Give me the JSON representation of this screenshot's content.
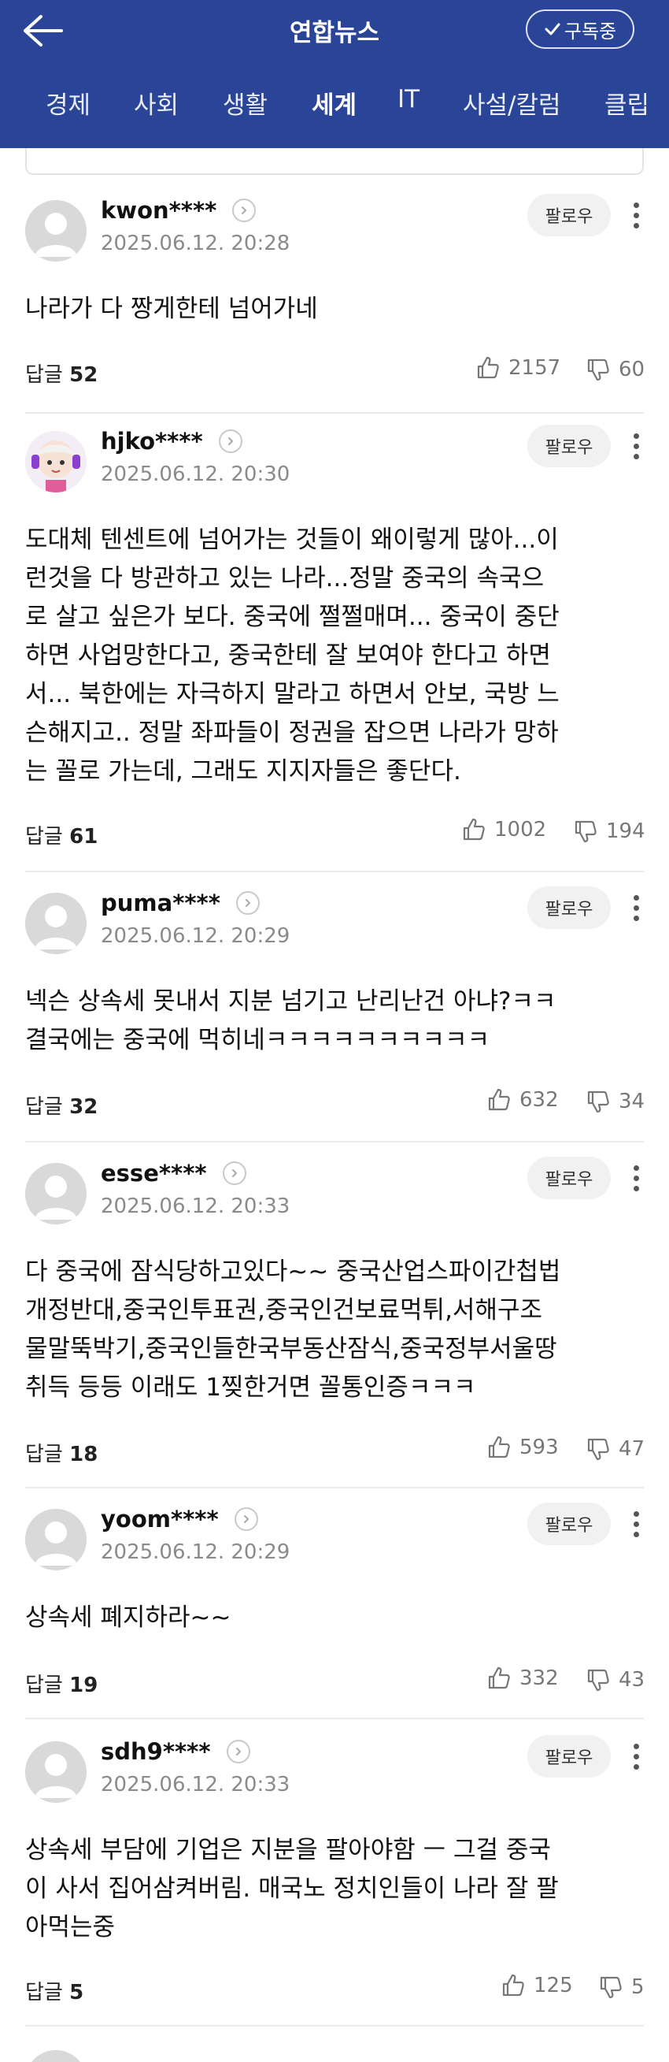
{
  "header": {
    "title": "연합뉴스",
    "subscribe_label": "구독중",
    "tabs": [
      "경제",
      "사회",
      "생활",
      "세계",
      "IT",
      "사설/칼럼",
      "클립"
    ],
    "active_tab": "세계"
  },
  "comments": [
    {
      "user": "kwon****",
      "time": "2025.06.12. 20:28",
      "follow": "팔로우",
      "text": "나라가 다 짱게한테 넘어가네",
      "replies_label": "답글",
      "replies": "52",
      "likes": "2157",
      "dislikes": "60",
      "avatar": "default-avatar"
    },
    {
      "user": "hjko****",
      "time": "2025.06.12. 20:30",
      "follow": "팔로우",
      "text": "도대체 텐센트에 넘어가는 것들이 왜이렇게 많아...이\n런것을 다 방관하고 있는 나라...정말 중국의 속국으\n로 살고 싶은가 보다. 중국에 쩔쩔매며... 중국이 중단\n하면 사업망한다고, 중국한테 잘 보여야 한다고 하면\n서... 북한에는 자극하지 말라고 하면서 안보, 국방 느\n슨해지고.. 정말 좌파들이 정권을 잡으면 나라가 망하\n는 꼴로 가는데, 그래도 지지자들은 좋단다.",
      "replies_label": "답글",
      "replies": "61",
      "likes": "1002",
      "dislikes": "194",
      "avatar": "character-avatar"
    },
    {
      "user": "puma****",
      "time": "2025.06.12. 20:29",
      "follow": "팔로우",
      "text": "넥슨 상속세 못내서 지분 넘기고 난리난건 아냐?ㅋㅋ\n결국에는 중국에 먹히네ㅋㅋㅋㅋㅋㅋㅋㅋㅋㅋ",
      "replies_label": "답글",
      "replies": "32",
      "likes": "632",
      "dislikes": "34",
      "avatar": "default-avatar"
    },
    {
      "user": "esse****",
      "time": "2025.06.12. 20:33",
      "follow": "팔로우",
      "text": "다 중국에 잠식당하고있다~~ 중국산업스파이간첩법\n개정반대,중국인투표권,중국인건보료먹튀,서해구조\n물말뚝박기,중국인들한국부동산잠식,중국정부서울땅\n취득 등등 이래도 1찢한거면 꼴통인증ㅋㅋㅋ",
      "replies_label": "답글",
      "replies": "18",
      "likes": "593",
      "dislikes": "47",
      "avatar": "default-avatar"
    },
    {
      "user": "yoom****",
      "time": "2025.06.12. 20:29",
      "follow": "팔로우",
      "text": "상속세 폐지하라~~",
      "replies_label": "답글",
      "replies": "19",
      "likes": "332",
      "dislikes": "43",
      "avatar": "default-avatar"
    },
    {
      "user": "sdh9****",
      "time": "2025.06.12. 20:33",
      "follow": "팔로우",
      "text": "상속세 부담에 기업은 지분을 팔아야함 ㅡ 그걸 중국\n이 사서 집어삼켜버림. 매국노 정치인들이 나라 잘 팔\n아먹는중",
      "replies_label": "답글",
      "replies": "5",
      "likes": "125",
      "dislikes": "5",
      "avatar": "default-avatar"
    }
  ],
  "icons": {
    "back": "back-arrow-icon",
    "check": "check-icon",
    "chevron": "chevron-right-icon",
    "more": "more-vertical-icon",
    "like": "thumbs-up-icon",
    "dislike": "thumbs-down-icon"
  },
  "colors": {
    "brand": "#2a4597",
    "muted": "#8a8a8a"
  }
}
